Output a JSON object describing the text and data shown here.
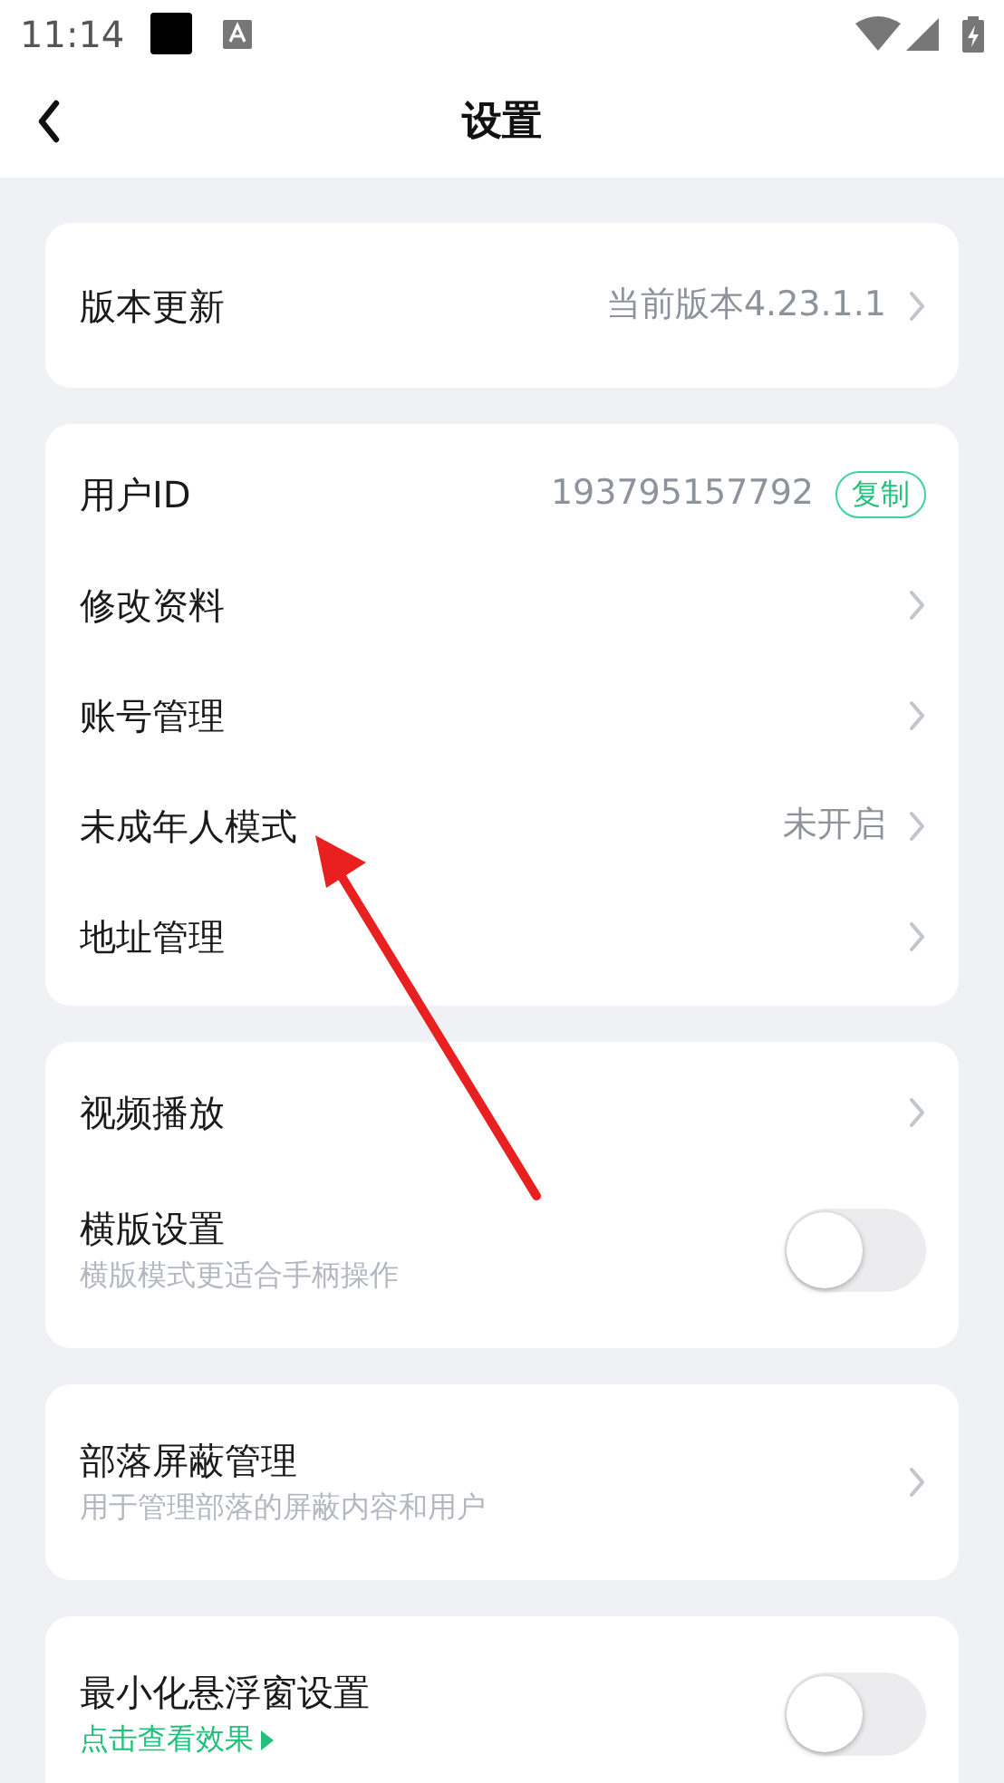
{
  "status_bar": {
    "time": "11:14"
  },
  "header": {
    "title": "设置"
  },
  "sections": [
    {
      "items": [
        {
          "kind": "link",
          "label": "版本更新",
          "value": "当前版本4.23.1.1"
        }
      ]
    },
    {
      "items": [
        {
          "kind": "copy",
          "label": "用户ID",
          "value": "193795157792",
          "button": "复制"
        },
        {
          "kind": "link",
          "label": "修改资料"
        },
        {
          "kind": "link",
          "label": "账号管理"
        },
        {
          "kind": "link",
          "label": "未成年人模式",
          "value": "未开启"
        },
        {
          "kind": "link",
          "label": "地址管理"
        }
      ]
    },
    {
      "items": [
        {
          "kind": "link",
          "label": "视频播放"
        },
        {
          "kind": "toggle",
          "label": "横版设置",
          "subtitle": "横版模式更适合手柄操作",
          "on": false
        }
      ]
    },
    {
      "items": [
        {
          "kind": "link",
          "label": "部落屏蔽管理",
          "subtitle": "用于管理部落的屏蔽内容和用户"
        }
      ]
    },
    {
      "items": [
        {
          "kind": "toggle",
          "label": "最小化悬浮窗设置",
          "link_text": "点击查看效果",
          "on": false
        }
      ]
    }
  ]
}
